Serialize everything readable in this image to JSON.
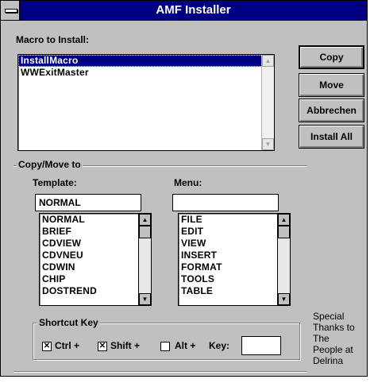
{
  "window": {
    "title": "AMF Installer"
  },
  "macro_section": {
    "label": "Macro to Install:",
    "items": [
      "InstallMacro",
      "WWExitMaster"
    ],
    "selected_index": 0
  },
  "buttons": {
    "copy": "Copy",
    "move": "Move",
    "attach": "Abbrechen",
    "install_all": "Install All"
  },
  "copy_move": {
    "label": "Copy/Move to"
  },
  "template": {
    "label": "Template:",
    "value": "NORMAL",
    "items": [
      "NORMAL",
      "BRIEF",
      "CDVIEW",
      "CDVNEU",
      "CDWIN",
      "CHIP",
      "DOSTREND"
    ]
  },
  "menu": {
    "label": "Menu:",
    "value": "",
    "items": [
      "FILE",
      "EDIT",
      "VIEW",
      "INSERT",
      "FORMAT",
      "TOOLS",
      "TABLE"
    ]
  },
  "shortcut": {
    "label": "Shortcut Key",
    "ctrl_label": "Ctrl +",
    "ctrl_checked": true,
    "shift_label": "Shift +",
    "shift_checked": true,
    "alt_label": "Alt +",
    "alt_checked": false,
    "key_label": "Key:",
    "key_value": ""
  },
  "thanks": {
    "text": "Special\nThanks to\nThe\nPeople at\nDelrina"
  },
  "icons": {
    "system_menu": "system-menu-icon",
    "scroll_up": "up-arrow-icon",
    "scroll_down": "down-arrow-icon",
    "check": "x-mark-icon"
  },
  "colors": {
    "titlebar": "#000080",
    "face": "#c0c0c0",
    "selection": "#000080"
  }
}
